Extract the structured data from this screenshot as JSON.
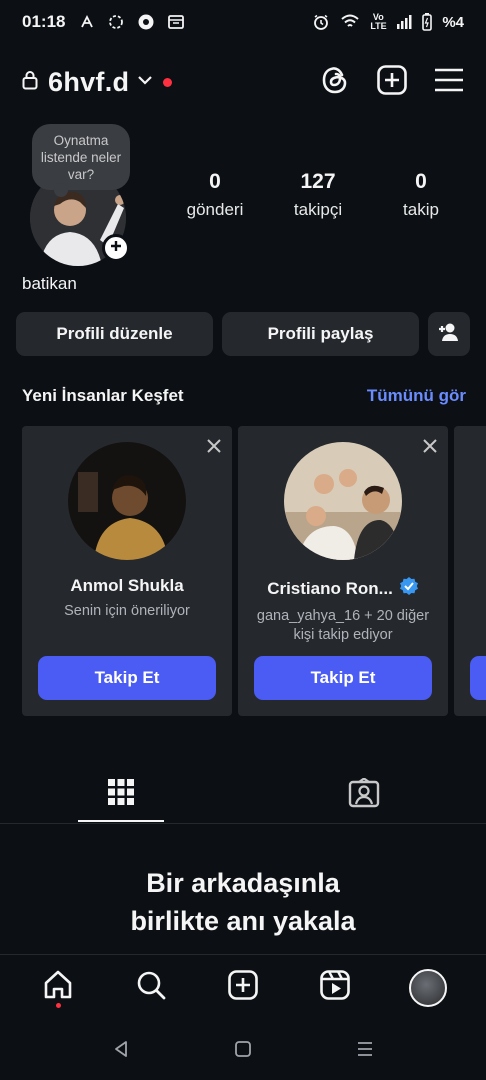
{
  "status_bar": {
    "time": "01:18",
    "network": "Vo LTE",
    "battery_text": "%4"
  },
  "header": {
    "username": "6hvf.d",
    "icons": [
      "lock-icon",
      "chevron-down-icon",
      "threads-icon",
      "create-post-icon",
      "menu-icon"
    ]
  },
  "profile": {
    "note": "Oynatma listende neler var?",
    "display_name": "batikan",
    "stats": [
      {
        "count": "0",
        "label": "gönderi"
      },
      {
        "count": "127",
        "label": "takipçi"
      },
      {
        "count": "0",
        "label": "takip"
      }
    ],
    "buttons": {
      "edit": "Profili düzenle",
      "share": "Profili paylaş"
    }
  },
  "discover": {
    "title": "Yeni İnsanlar Keşfet",
    "see_all": "Tümünü gör",
    "cards": [
      {
        "name": "Anmol Shukla",
        "subtitle": "Senin için öneriliyor",
        "button": "Takip Et",
        "verified": false
      },
      {
        "name": "Cristiano Ron...",
        "subtitle": "gana_yahya_16 + 20 diğer kişi takip ediyor",
        "button": "Takip Et",
        "verified": true
      }
    ]
  },
  "content": {
    "cta_line1": "Bir arkadaşınla",
    "cta_line2": "birlikte anı yakala"
  },
  "colors": {
    "background": "#0c1014",
    "accent": "#4a5cf3",
    "link": "#6b8cff",
    "notification": "#ff3040"
  }
}
